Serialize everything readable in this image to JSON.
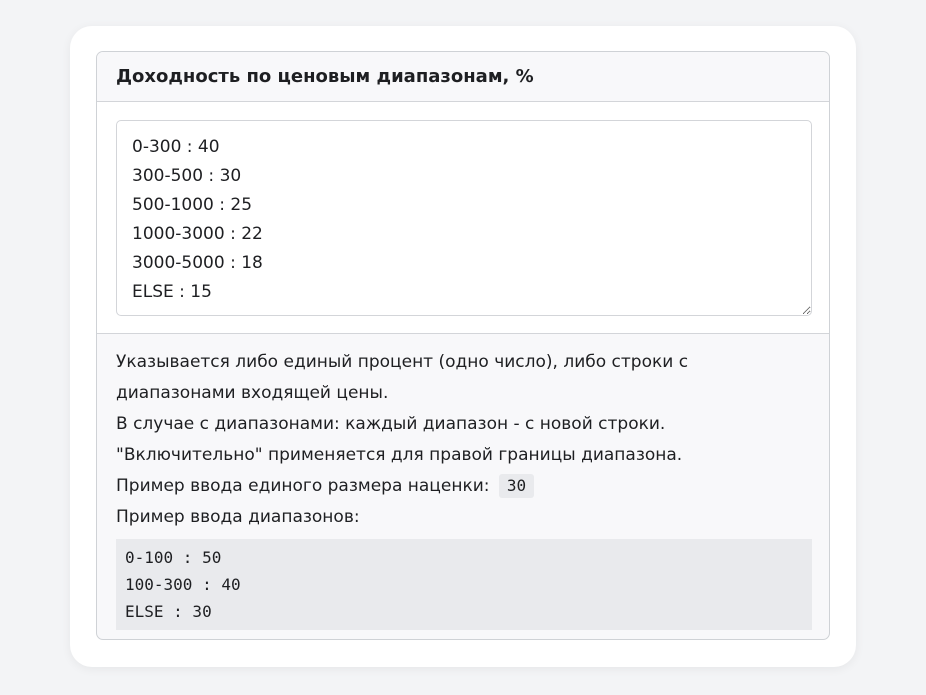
{
  "panel": {
    "title": "Доходность по ценовым диапазонам, %"
  },
  "ranges_field": {
    "value": "0-300 : 40\n300-500 : 30\n500-1000 : 25\n1000-3000 : 22\n3000-5000 : 18\nELSE : 15"
  },
  "help": {
    "line1": "Указывается либо единый процент (одно число), либо строки с диапазонами входящей цены.",
    "line2": "В случае с диапазонами: каждый диапазон - с новой строки. \"Включительно\" применяется для правой границы диапазона.",
    "single_example_label": "Пример ввода единого размера наценки:",
    "single_example_value": "30",
    "ranges_example_label": "Пример ввода диапазонов:",
    "ranges_example_lines": [
      "0-100 : 50",
      "100-300 : 40",
      "ELSE : 30"
    ]
  }
}
